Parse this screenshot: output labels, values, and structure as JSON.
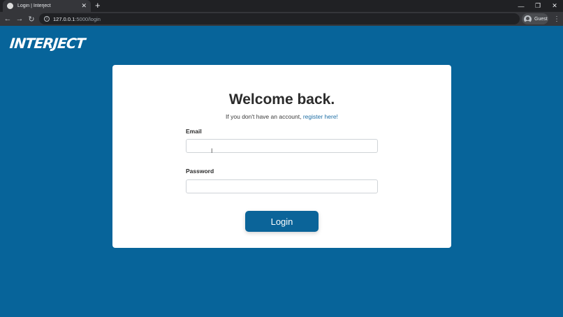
{
  "browser": {
    "tab_title": "Login | Interject",
    "tab_close": "✕",
    "new_tab": "+",
    "window_controls": {
      "minimize": "—",
      "restore": "❐",
      "close": "✕"
    },
    "nav": {
      "back": "←",
      "forward": "→",
      "reload": "↻"
    },
    "url_host": "127.0.0.1",
    "url_path": ":5000/login",
    "profile_label": "Guest",
    "menu": "⋮"
  },
  "page": {
    "logo": "INTERJECT",
    "heading": "Welcome back.",
    "subtext_prefix": "If you don't have an account,",
    "register_link": "register here!",
    "email_label": "Email",
    "email_value": "",
    "password_label": "Password",
    "password_value": "",
    "login_button": "Login"
  },
  "colors": {
    "background": "#07649a",
    "accent": "#0b6499",
    "link": "#1f6fa5"
  }
}
